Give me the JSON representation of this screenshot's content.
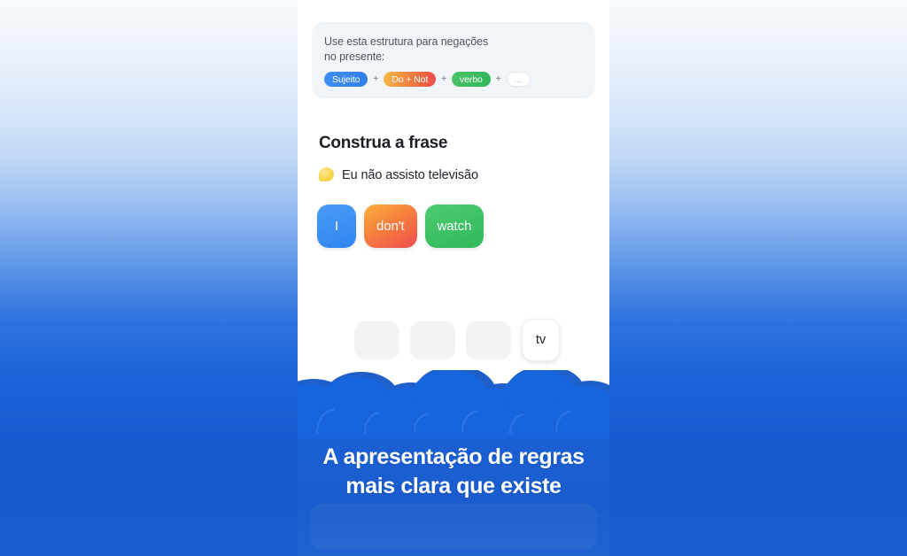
{
  "background": {
    "gradient_top": "#f7fafd",
    "gradient_bottom": "#1a5cd0"
  },
  "app": {
    "rule_card": {
      "line1": "Use esta estrutura para negações",
      "line2": "no presente:",
      "chips": [
        {
          "label": "Sujeito",
          "color": "#3f8ef5",
          "kind": "subject"
        },
        {
          "label": "Do + Not",
          "color": "#f07a3e",
          "kind": "auxiliary"
        },
        {
          "label": "verbo",
          "color": "#3cbd62",
          "kind": "verb"
        },
        {
          "label": "...",
          "color": "#9aa3ae",
          "kind": "more"
        }
      ],
      "separator": "+"
    },
    "exercise": {
      "title": "Construa a frase",
      "prompt": "Eu não assisto televisão",
      "prompt_icon": "speech-bubble-icon",
      "word_tiles": [
        {
          "label": "I",
          "color": "#3b8ef0"
        },
        {
          "label": "don't",
          "color": "#f6803e"
        },
        {
          "label": "watch",
          "color": "#35bd60"
        }
      ],
      "answer_slots": [
        {
          "label": "",
          "filled": false
        },
        {
          "label": "",
          "filled": false
        },
        {
          "label": "",
          "filled": false
        },
        {
          "label": "tv",
          "filled": true
        }
      ],
      "cursor_icon": "pointing-hand-icon"
    }
  },
  "promo": {
    "headline_line1": "A apresentação de regras",
    "headline_line2": "mais clara que existe"
  }
}
